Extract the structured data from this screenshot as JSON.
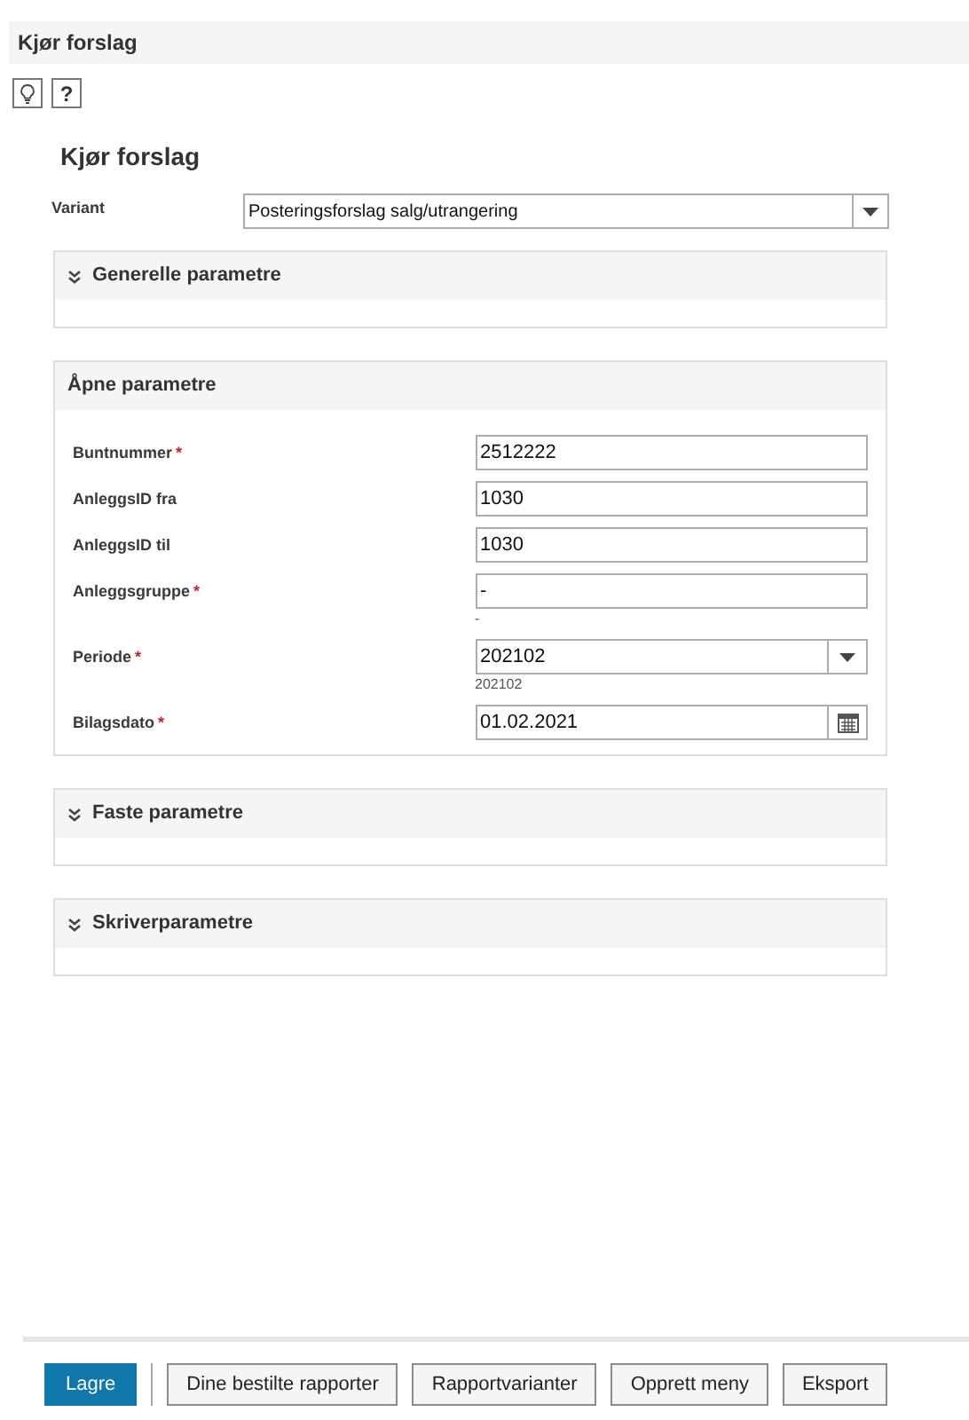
{
  "header": {
    "title": "Kjør forslag"
  },
  "required_mark": "*",
  "toolbar": [
    {
      "kind": "tip"
    },
    {
      "kind": "help",
      "label": "?"
    }
  ],
  "form_title": "Kjør forslag",
  "variant": {
    "label": "Variant",
    "value": "Posteringsforslag salg/utrangering"
  },
  "sections": [
    {
      "title": "Generelle parametre",
      "expanded": false
    },
    {
      "title": "Åpne parametre",
      "expanded": true,
      "fields": [
        {
          "label": "Buntnummer",
          "required": true,
          "kind": "text",
          "value": "2512222"
        },
        {
          "label": "AnleggsID fra",
          "required": false,
          "kind": "text",
          "value": "1030"
        },
        {
          "label": "AnleggsID til",
          "required": false,
          "kind": "text",
          "value": "1030"
        },
        {
          "label": "Anleggsgruppe",
          "required": true,
          "kind": "text",
          "value": "-",
          "hint": "-"
        },
        {
          "label": "Periode",
          "required": true,
          "kind": "select",
          "value": "202102",
          "hint": "202102"
        },
        {
          "label": "Bilagsdato",
          "required": true,
          "kind": "date",
          "value": "01.02.2021"
        }
      ]
    },
    {
      "title": "Faste parametre",
      "expanded": false
    },
    {
      "title": "Skriverparametre",
      "expanded": false
    }
  ],
  "buttons": [
    {
      "label": "Lagre",
      "kind": "primary"
    },
    {
      "label": "Dine bestilte rapporter",
      "kind": "secondary"
    },
    {
      "label": "Rapportvarianter",
      "kind": "secondary"
    },
    {
      "label": "Opprett meny",
      "kind": "secondary"
    },
    {
      "label": "Eksport",
      "kind": "secondary"
    }
  ]
}
